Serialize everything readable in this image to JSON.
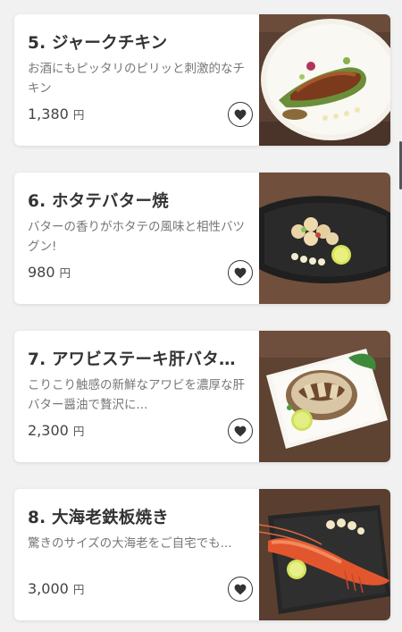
{
  "menu": {
    "currency_unit": "円",
    "items": [
      {
        "title": "5. ジャークチキン",
        "description": "お酒にもピッタリのピリッと刺激的なチキン",
        "price": "1,380",
        "favorite_icon": "heart-icon",
        "photo": "jerk-chicken-photo"
      },
      {
        "title": "6. ホタテバター焼",
        "description": "バターの香りがホタテの風味と相性バツグン!",
        "price": "980",
        "favorite_icon": "heart-icon",
        "photo": "scallop-butter-photo"
      },
      {
        "title": "7. アワビステーキ肝バタ…",
        "description": "こりこり触感の新鮮なアワビを濃厚な肝バター醤油で贅沢に...",
        "price": "2,300",
        "favorite_icon": "heart-icon",
        "photo": "abalone-steak-photo"
      },
      {
        "title": "8. 大海老鉄板焼き",
        "description": "驚きのサイズの大海老をご自宅でも...",
        "price": "3,000",
        "favorite_icon": "heart-icon",
        "photo": "giant-prawn-photo"
      }
    ]
  },
  "colors": {
    "background": "#f1f1f1",
    "card": "#ffffff",
    "title": "#333333",
    "description": "#777777",
    "icon": "#333333"
  }
}
